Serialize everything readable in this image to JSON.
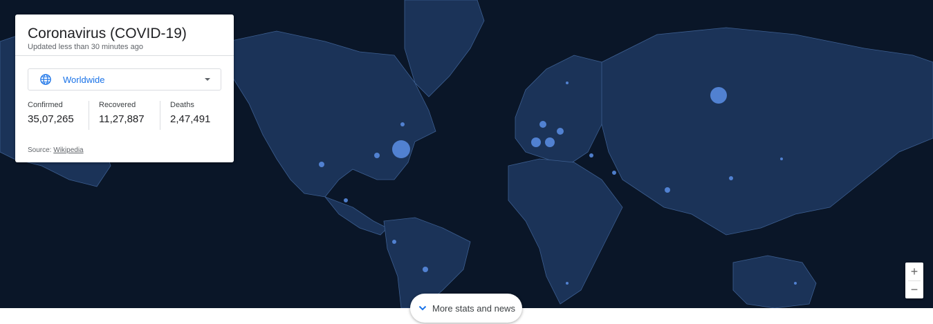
{
  "card": {
    "title": "Coronavirus (COVID-19)",
    "subtitle": "Updated less than 30 minutes ago",
    "region": {
      "selected": "Worldwide",
      "icon": "globe-icon"
    },
    "stats": [
      {
        "label": "Confirmed",
        "value": "35,07,265"
      },
      {
        "label": "Recovered",
        "value": "11,27,887"
      },
      {
        "label": "Deaths",
        "value": "2,47,491"
      }
    ],
    "source_prefix": "Source:",
    "source_link": "Wikipedia"
  },
  "map": {
    "colors": {
      "ocean": "#0a1628",
      "land": "#1b3358",
      "borders": "#3d5f91",
      "case_dots": "#5a8fe6"
    },
    "zoom": {
      "in_label": "+",
      "out_label": "−"
    }
  },
  "footer": {
    "more_label": "More stats and news",
    "icon": "chevron-down-icon"
  },
  "accent_color": "#1a73e8"
}
